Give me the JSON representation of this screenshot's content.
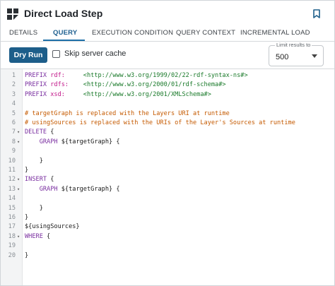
{
  "header": {
    "title": "Direct Load Step",
    "icon": "grid-icon",
    "bookmark_icon": "bookmark-icon"
  },
  "tabs": [
    {
      "label": "DETAILS",
      "active": false
    },
    {
      "label": "QUERY",
      "active": true
    },
    {
      "label": "EXECUTION CONDITION",
      "active": false
    },
    {
      "label": "QUERY CONTEXT",
      "active": false
    },
    {
      "label": "INCREMENTAL LOAD",
      "active": false
    }
  ],
  "toolbar": {
    "dry_run_label": "Dry Run",
    "skip_cache_label": "Skip server cache",
    "skip_cache_checked": false,
    "limit_label": "Limit results to",
    "limit_value": "500"
  },
  "colors": {
    "accent": "#1d5e8a",
    "keyword": "#7a2fa0",
    "prefix": "#c2188a",
    "iri": "#1a7a2a",
    "comment": "#c55a00"
  },
  "editor": {
    "lines": [
      {
        "n": "1",
        "fold": "",
        "parts": [
          {
            "t": "PREFIX ",
            "c": "kw"
          },
          {
            "t": "rdf:     ",
            "c": "pfx"
          },
          {
            "t": "<http://www.w3.org/1999/02/22-rdf-syntax-ns#>",
            "c": "iri"
          }
        ]
      },
      {
        "n": "2",
        "fold": "",
        "parts": [
          {
            "t": "PREFIX ",
            "c": "kw"
          },
          {
            "t": "rdfs:    ",
            "c": "pfx"
          },
          {
            "t": "<http://www.w3.org/2000/01/rdf-schema#>",
            "c": "iri"
          }
        ]
      },
      {
        "n": "3",
        "fold": "",
        "parts": [
          {
            "t": "PREFIX ",
            "c": "kw"
          },
          {
            "t": "xsd:     ",
            "c": "pfx"
          },
          {
            "t": "<http://www.w3.org/2001/XMLSchema#>",
            "c": "iri"
          }
        ]
      },
      {
        "n": "4",
        "fold": "",
        "parts": []
      },
      {
        "n": "5",
        "fold": "",
        "parts": [
          {
            "t": "# targetGraph is replaced with the Layers URI at runtime",
            "c": "cm"
          }
        ]
      },
      {
        "n": "6",
        "fold": "",
        "parts": [
          {
            "t": "# usingSources is replaced with the URIs of the Layer's Sources at runtime",
            "c": "cm"
          }
        ]
      },
      {
        "n": "7",
        "fold": "▾",
        "parts": [
          {
            "t": "DELETE ",
            "c": "kw"
          },
          {
            "t": "{",
            "c": "var"
          }
        ]
      },
      {
        "n": "8",
        "fold": "▾",
        "parts": [
          {
            "t": "    GRAPH ",
            "c": "kw"
          },
          {
            "t": "${targetGraph} {",
            "c": "var"
          }
        ]
      },
      {
        "n": "9",
        "fold": "",
        "parts": []
      },
      {
        "n": "10",
        "fold": "",
        "parts": [
          {
            "t": "    }",
            "c": "var"
          }
        ]
      },
      {
        "n": "11",
        "fold": "",
        "parts": [
          {
            "t": "}",
            "c": "var"
          }
        ]
      },
      {
        "n": "12",
        "fold": "▾",
        "parts": [
          {
            "t": "INSERT ",
            "c": "kw"
          },
          {
            "t": "{",
            "c": "var"
          }
        ]
      },
      {
        "n": "13",
        "fold": "▾",
        "parts": [
          {
            "t": "    GRAPH ",
            "c": "kw"
          },
          {
            "t": "${targetGraph} {",
            "c": "var"
          }
        ]
      },
      {
        "n": "14",
        "fold": "",
        "parts": []
      },
      {
        "n": "15",
        "fold": "",
        "parts": [
          {
            "t": "    }",
            "c": "var"
          }
        ]
      },
      {
        "n": "16",
        "fold": "",
        "parts": [
          {
            "t": "}",
            "c": "var"
          }
        ]
      },
      {
        "n": "17",
        "fold": "",
        "parts": [
          {
            "t": "${usingSources}",
            "c": "var"
          }
        ]
      },
      {
        "n": "18",
        "fold": "▾",
        "parts": [
          {
            "t": "WHERE ",
            "c": "kw"
          },
          {
            "t": "{",
            "c": "var"
          }
        ]
      },
      {
        "n": "19",
        "fold": "",
        "parts": []
      },
      {
        "n": "20",
        "fold": "",
        "parts": [
          {
            "t": "}",
            "c": "var"
          }
        ]
      }
    ]
  }
}
